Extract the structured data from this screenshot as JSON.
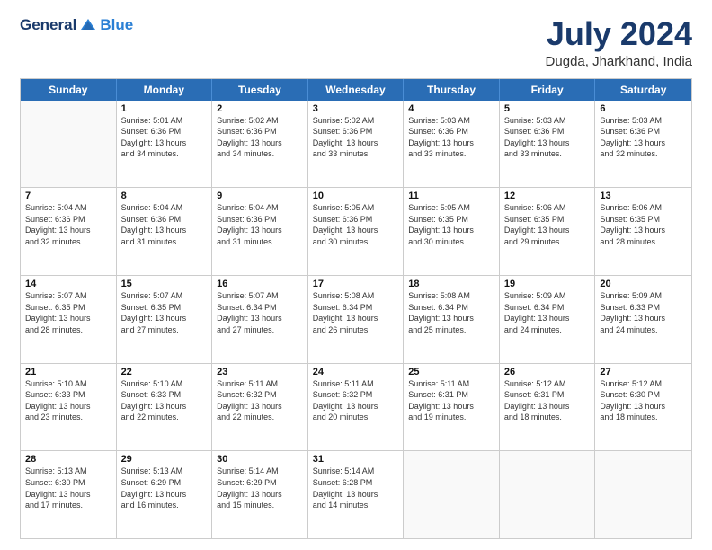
{
  "header": {
    "logo_general": "General",
    "logo_blue": "Blue",
    "month_title": "July 2024",
    "location": "Dugda, Jharkhand, India"
  },
  "days_of_week": [
    "Sunday",
    "Monday",
    "Tuesday",
    "Wednesday",
    "Thursday",
    "Friday",
    "Saturday"
  ],
  "weeks": [
    [
      {
        "day": "",
        "info": ""
      },
      {
        "day": "1",
        "info": "Sunrise: 5:01 AM\nSunset: 6:36 PM\nDaylight: 13 hours\nand 34 minutes."
      },
      {
        "day": "2",
        "info": "Sunrise: 5:02 AM\nSunset: 6:36 PM\nDaylight: 13 hours\nand 34 minutes."
      },
      {
        "day": "3",
        "info": "Sunrise: 5:02 AM\nSunset: 6:36 PM\nDaylight: 13 hours\nand 33 minutes."
      },
      {
        "day": "4",
        "info": "Sunrise: 5:03 AM\nSunset: 6:36 PM\nDaylight: 13 hours\nand 33 minutes."
      },
      {
        "day": "5",
        "info": "Sunrise: 5:03 AM\nSunset: 6:36 PM\nDaylight: 13 hours\nand 33 minutes."
      },
      {
        "day": "6",
        "info": "Sunrise: 5:03 AM\nSunset: 6:36 PM\nDaylight: 13 hours\nand 32 minutes."
      }
    ],
    [
      {
        "day": "7",
        "info": "Sunrise: 5:04 AM\nSunset: 6:36 PM\nDaylight: 13 hours\nand 32 minutes."
      },
      {
        "day": "8",
        "info": "Sunrise: 5:04 AM\nSunset: 6:36 PM\nDaylight: 13 hours\nand 31 minutes."
      },
      {
        "day": "9",
        "info": "Sunrise: 5:04 AM\nSunset: 6:36 PM\nDaylight: 13 hours\nand 31 minutes."
      },
      {
        "day": "10",
        "info": "Sunrise: 5:05 AM\nSunset: 6:36 PM\nDaylight: 13 hours\nand 30 minutes."
      },
      {
        "day": "11",
        "info": "Sunrise: 5:05 AM\nSunset: 6:35 PM\nDaylight: 13 hours\nand 30 minutes."
      },
      {
        "day": "12",
        "info": "Sunrise: 5:06 AM\nSunset: 6:35 PM\nDaylight: 13 hours\nand 29 minutes."
      },
      {
        "day": "13",
        "info": "Sunrise: 5:06 AM\nSunset: 6:35 PM\nDaylight: 13 hours\nand 28 minutes."
      }
    ],
    [
      {
        "day": "14",
        "info": "Sunrise: 5:07 AM\nSunset: 6:35 PM\nDaylight: 13 hours\nand 28 minutes."
      },
      {
        "day": "15",
        "info": "Sunrise: 5:07 AM\nSunset: 6:35 PM\nDaylight: 13 hours\nand 27 minutes."
      },
      {
        "day": "16",
        "info": "Sunrise: 5:07 AM\nSunset: 6:34 PM\nDaylight: 13 hours\nand 27 minutes."
      },
      {
        "day": "17",
        "info": "Sunrise: 5:08 AM\nSunset: 6:34 PM\nDaylight: 13 hours\nand 26 minutes."
      },
      {
        "day": "18",
        "info": "Sunrise: 5:08 AM\nSunset: 6:34 PM\nDaylight: 13 hours\nand 25 minutes."
      },
      {
        "day": "19",
        "info": "Sunrise: 5:09 AM\nSunset: 6:34 PM\nDaylight: 13 hours\nand 24 minutes."
      },
      {
        "day": "20",
        "info": "Sunrise: 5:09 AM\nSunset: 6:33 PM\nDaylight: 13 hours\nand 24 minutes."
      }
    ],
    [
      {
        "day": "21",
        "info": "Sunrise: 5:10 AM\nSunset: 6:33 PM\nDaylight: 13 hours\nand 23 minutes."
      },
      {
        "day": "22",
        "info": "Sunrise: 5:10 AM\nSunset: 6:33 PM\nDaylight: 13 hours\nand 22 minutes."
      },
      {
        "day": "23",
        "info": "Sunrise: 5:11 AM\nSunset: 6:32 PM\nDaylight: 13 hours\nand 22 minutes."
      },
      {
        "day": "24",
        "info": "Sunrise: 5:11 AM\nSunset: 6:32 PM\nDaylight: 13 hours\nand 20 minutes."
      },
      {
        "day": "25",
        "info": "Sunrise: 5:11 AM\nSunset: 6:31 PM\nDaylight: 13 hours\nand 19 minutes."
      },
      {
        "day": "26",
        "info": "Sunrise: 5:12 AM\nSunset: 6:31 PM\nDaylight: 13 hours\nand 18 minutes."
      },
      {
        "day": "27",
        "info": "Sunrise: 5:12 AM\nSunset: 6:30 PM\nDaylight: 13 hours\nand 18 minutes."
      }
    ],
    [
      {
        "day": "28",
        "info": "Sunrise: 5:13 AM\nSunset: 6:30 PM\nDaylight: 13 hours\nand 17 minutes."
      },
      {
        "day": "29",
        "info": "Sunrise: 5:13 AM\nSunset: 6:29 PM\nDaylight: 13 hours\nand 16 minutes."
      },
      {
        "day": "30",
        "info": "Sunrise: 5:14 AM\nSunset: 6:29 PM\nDaylight: 13 hours\nand 15 minutes."
      },
      {
        "day": "31",
        "info": "Sunrise: 5:14 AM\nSunset: 6:28 PM\nDaylight: 13 hours\nand 14 minutes."
      },
      {
        "day": "",
        "info": ""
      },
      {
        "day": "",
        "info": ""
      },
      {
        "day": "",
        "info": ""
      }
    ]
  ]
}
